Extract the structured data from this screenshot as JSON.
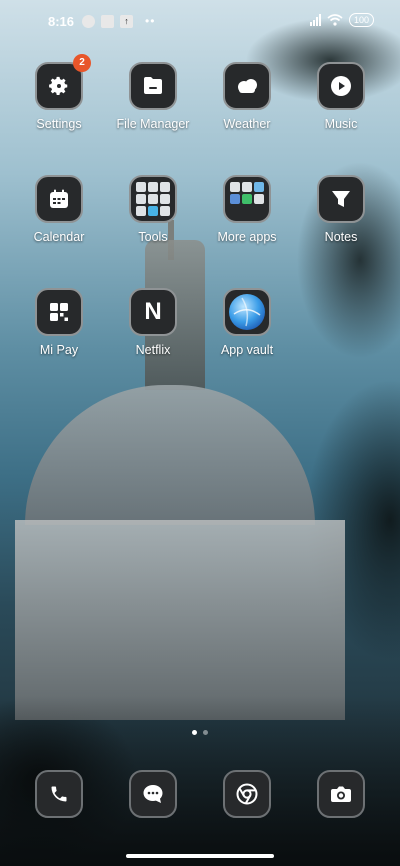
{
  "status_bar": {
    "time": "8:16",
    "battery": "100"
  },
  "apps": {
    "settings": {
      "label": "Settings",
      "badge": "2"
    },
    "file_manager": {
      "label": "File Manager"
    },
    "weather": {
      "label": "Weather"
    },
    "music": {
      "label": "Music"
    },
    "calendar": {
      "label": "Calendar"
    },
    "tools": {
      "label": "Tools"
    },
    "more_apps": {
      "label": "More apps"
    },
    "notes": {
      "label": "Notes"
    },
    "mi_pay": {
      "label": "Mi Pay"
    },
    "netflix": {
      "label": "Netflix",
      "glyph": "N"
    },
    "app_vault": {
      "label": "App vault"
    }
  },
  "dock": [
    "phone-icon",
    "messages-icon",
    "chrome-icon",
    "camera-icon"
  ],
  "page_indicator": {
    "pages": 2,
    "current": 1
  },
  "colors": {
    "badge": "#e8562a",
    "tile": "#27292b",
    "tile_border": "#8f9395"
  }
}
